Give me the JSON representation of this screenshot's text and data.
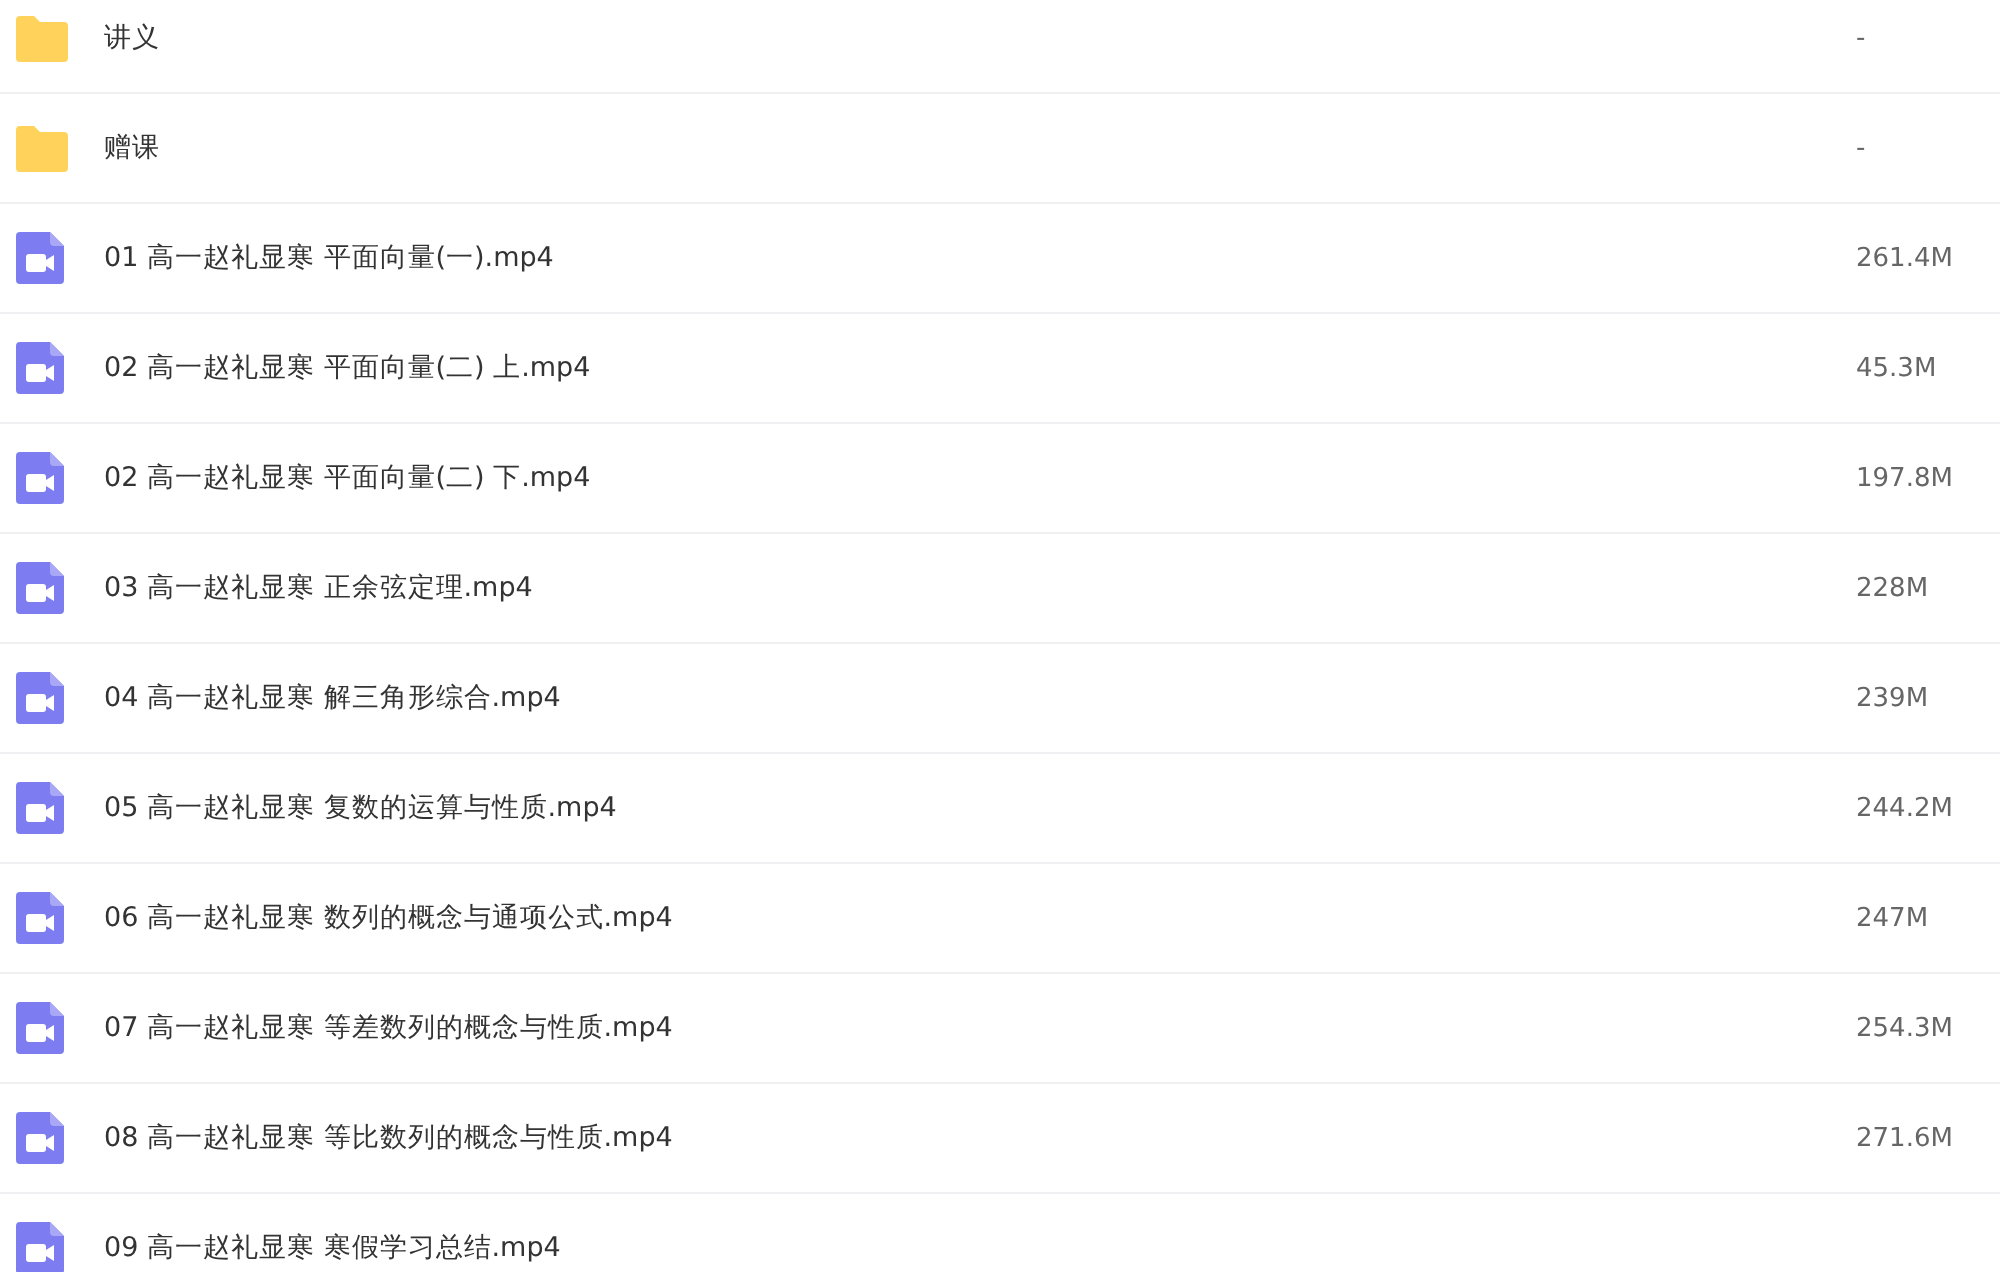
{
  "files": [
    {
      "kind": "folder",
      "name": "讲义",
      "size": "-"
    },
    {
      "kind": "folder",
      "name": "赠课",
      "size": "-"
    },
    {
      "kind": "video",
      "name": "01 高一赵礼显寒 平面向量(一).mp4",
      "size": "261.4M"
    },
    {
      "kind": "video",
      "name": "02 高一赵礼显寒 平面向量(二) 上.mp4",
      "size": "45.3M"
    },
    {
      "kind": "video",
      "name": "02 高一赵礼显寒 平面向量(二) 下.mp4",
      "size": "197.8M"
    },
    {
      "kind": "video",
      "name": "03 高一赵礼显寒 正余弦定理.mp4",
      "size": "228M"
    },
    {
      "kind": "video",
      "name": "04 高一赵礼显寒 解三角形综合.mp4",
      "size": "239M"
    },
    {
      "kind": "video",
      "name": "05 高一赵礼显寒 复数的运算与性质.mp4",
      "size": "244.2M"
    },
    {
      "kind": "video",
      "name": "06 高一赵礼显寒 数列的概念与通项公式.mp4",
      "size": "247M"
    },
    {
      "kind": "video",
      "name": "07 高一赵礼显寒 等差数列的概念与性质.mp4",
      "size": "254.3M"
    },
    {
      "kind": "video",
      "name": "08 高一赵礼显寒 等比数列的概念与性质.mp4",
      "size": "271.6M"
    },
    {
      "kind": "video",
      "name": "09 高一赵礼显寒 寒假学习总结.mp4"
    }
  ]
}
